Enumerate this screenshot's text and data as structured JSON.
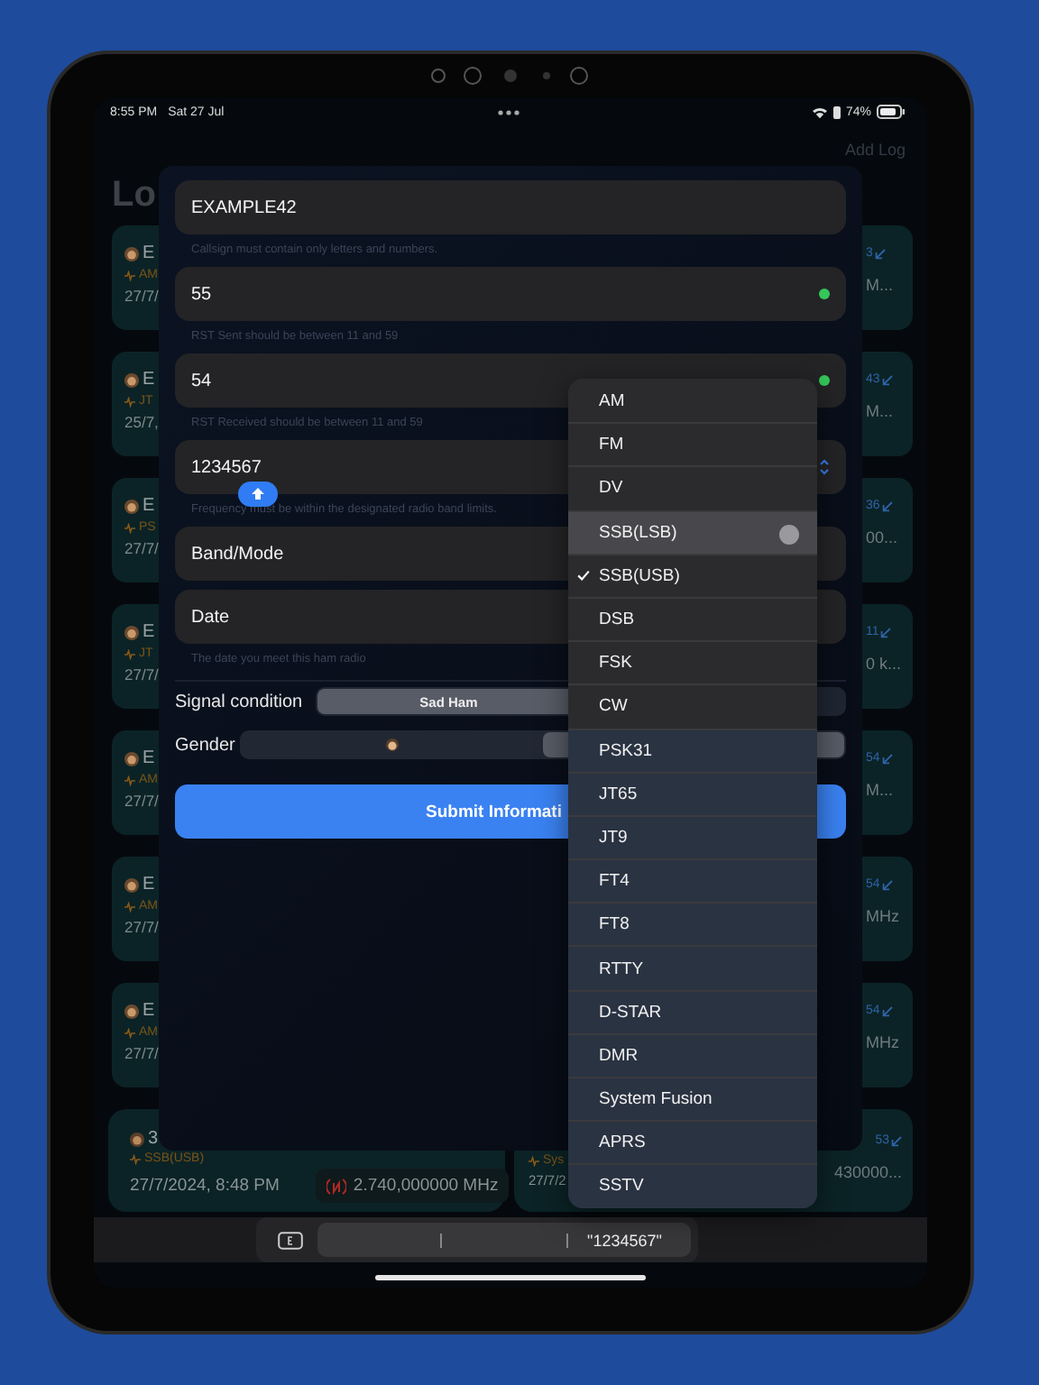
{
  "status_bar": {
    "time": "8:55 PM",
    "date": "Sat 27 Jul",
    "battery": "74%"
  },
  "header": {
    "action": "Add Log",
    "title": "Lo"
  },
  "log_cards": [
    {
      "name": "E",
      "mode": "AM",
      "date": "27/7/",
      "count": "3",
      "detail": "M..."
    },
    {
      "name": "E",
      "mode": "JT",
      "date": "25/7,",
      "count": "43",
      "detail": "M..."
    },
    {
      "name": "E",
      "mode": "PS",
      "date": "27/7/",
      "count": "36",
      "detail": "00..."
    },
    {
      "name": "E",
      "mode": "JT",
      "date": "27/7/",
      "count": "11",
      "detail": "0 k..."
    },
    {
      "name": "E",
      "mode": "AM",
      "date": "27/7/",
      "count": "54",
      "detail": "M..."
    },
    {
      "name": "E",
      "mode": "AM",
      "date": "27/7/",
      "count": "54",
      "detail": "MHz"
    },
    {
      "name": "E",
      "mode": "AM",
      "date": "27/7/",
      "count": "54",
      "detail": "MHz"
    }
  ],
  "bottom_cards": [
    {
      "name": "3",
      "mode": "SSB(USB)",
      "date": "27/7/2024, 8:48 PM",
      "frequency": "2.740,000000 MHz"
    },
    {
      "mode": "Sys",
      "date": "27/7/2",
      "count": "53",
      "frequency": "430000..."
    }
  ],
  "form": {
    "fields": [
      {
        "kind": "text",
        "value": "EXAMPLE42",
        "valid": false,
        "helper": "Callsign must contain only letters and numbers."
      },
      {
        "kind": "text",
        "value": "55",
        "valid": true,
        "helper": "RST Sent should be between 11 and 59"
      },
      {
        "kind": "text",
        "value": "54",
        "valid": true,
        "helper": "RST Received should be between 11 and 59"
      },
      {
        "kind": "stepper",
        "value": "1234567",
        "helper": "Frequency must be within the designated radio band limits."
      },
      {
        "kind": "picker",
        "value": "Band/Mode"
      },
      {
        "kind": "date",
        "value": "Date",
        "helper": "The date you meet this ham radio"
      }
    ],
    "signal_condition": {
      "label": "Signal condition",
      "options": [
        {
          "label": "Sad Ham",
          "selected": true
        },
        {
          "selected": false
        }
      ]
    },
    "gender": {
      "label": "Gender",
      "options": [
        {
          "kind": "male",
          "selected": false
        },
        {
          "selected": true
        }
      ]
    },
    "submit": "Submit Informati"
  },
  "mode_menu": [
    {
      "label": "AM",
      "selected": false,
      "highlighted": false
    },
    {
      "label": "FM",
      "selected": false,
      "highlighted": false
    },
    {
      "label": "DV",
      "selected": false,
      "highlighted": false
    },
    {
      "label": "SSB(LSB)",
      "selected": false,
      "highlighted": true
    },
    {
      "label": "SSB(USB)",
      "selected": true,
      "highlighted": false
    },
    {
      "label": "DSB",
      "selected": false,
      "highlighted": false
    },
    {
      "label": "FSK",
      "selected": false,
      "highlighted": false
    },
    {
      "label": "CW",
      "selected": false,
      "highlighted": false
    },
    {
      "label": "PSK31",
      "selected": false,
      "highlighted": false
    },
    {
      "label": "JT65",
      "selected": false,
      "highlighted": false
    },
    {
      "label": "JT9",
      "selected": false,
      "highlighted": false
    },
    {
      "label": "FT4",
      "selected": false,
      "highlighted": false
    },
    {
      "label": "FT8",
      "selected": false,
      "highlighted": false
    },
    {
      "label": "RTTY",
      "selected": false,
      "highlighted": false
    },
    {
      "label": "D-STAR",
      "selected": false,
      "highlighted": false
    },
    {
      "label": "DMR",
      "selected": false,
      "highlighted": false
    },
    {
      "label": "System Fusion",
      "selected": false,
      "highlighted": false
    },
    {
      "label": "APRS",
      "selected": false,
      "highlighted": false
    },
    {
      "label": "SSTV",
      "selected": false,
      "highlighted": false
    }
  ],
  "keyboard_bar": {
    "suggestion": "\"1234567\""
  }
}
